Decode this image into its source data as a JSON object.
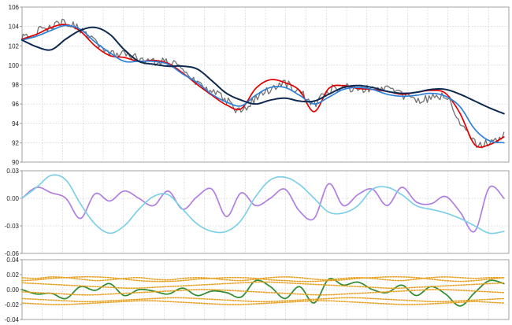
{
  "chart_data": [
    {
      "type": "line",
      "panel": "price",
      "ylim": [
        90,
        106
      ],
      "yticks": [
        "106",
        "104",
        "102",
        "100",
        "98",
        "96",
        "94",
        "92",
        "90"
      ],
      "xlim": [
        0,
        100
      ],
      "grid": true,
      "x": [
        0,
        3,
        6,
        9,
        12,
        15,
        18,
        21,
        24,
        27,
        30,
        33,
        36,
        39,
        42,
        45,
        48,
        51,
        54,
        57,
        60,
        63,
        66,
        69,
        72,
        75,
        78,
        81,
        84,
        87,
        90,
        93,
        96,
        99
      ],
      "series": [
        {
          "color": "#707070",
          "style": "noisy-price",
          "values": [
            102.9,
            103.4,
            104.1,
            104.4,
            103.6,
            102.3,
            101.2,
            101.3,
            100.6,
            100.3,
            100.3,
            99.8,
            98.2,
            97.3,
            96.4,
            95.3,
            96.6,
            97.5,
            98.0,
            97.3,
            96.1,
            97.4,
            97.7,
            97.6,
            97.6,
            97.5,
            96.9,
            96.5,
            96.6,
            96.7,
            94.2,
            91.9,
            92.1,
            92.8
          ]
        },
        {
          "color": "#e00000",
          "values": [
            102.7,
            103.2,
            103.9,
            104.2,
            103.5,
            102.0,
            101.0,
            100.8,
            100.4,
            100.5,
            100.2,
            99.2,
            98.0,
            96.9,
            95.9,
            95.5,
            97.6,
            98.5,
            98.2,
            97.4,
            95.2,
            97.6,
            97.9,
            97.6,
            97.5,
            97.3,
            97.0,
            97.2,
            97.4,
            97.1,
            95.0,
            91.8,
            91.8,
            92.6
          ]
        },
        {
          "color": "#2f80d8",
          "values": [
            102.6,
            103.0,
            103.6,
            104.1,
            103.7,
            102.4,
            101.3,
            100.4,
            100.4,
            100.4,
            100.1,
            99.1,
            98.2,
            97.0,
            96.2,
            95.8,
            96.9,
            97.7,
            97.7,
            96.9,
            96.0,
            96.7,
            97.5,
            97.7,
            97.5,
            97.0,
            96.8,
            96.9,
            97.1,
            96.8,
            95.7,
            93.4,
            92.2,
            92.0
          ]
        },
        {
          "color": "#0e2a50",
          "values": [
            102.6,
            101.9,
            101.6,
            102.7,
            103.6,
            103.9,
            103.2,
            101.6,
            100.4,
            100.1,
            99.9,
            99.9,
            99.6,
            98.4,
            97.1,
            96.4,
            96.0,
            96.4,
            96.6,
            96.3,
            96.3,
            97.0,
            97.7,
            97.9,
            97.7,
            97.3,
            97.1,
            97.2,
            97.5,
            97.5,
            97.0,
            96.3,
            95.6,
            95.0
          ]
        }
      ]
    },
    {
      "type": "line",
      "panel": "oscillator",
      "ylim": [
        -0.06,
        0.03
      ],
      "yticks": [
        "0.03",
        "0.00",
        "-0.03",
        "-0.06"
      ],
      "xlim": [
        0,
        100
      ],
      "grid": true,
      "x": [
        0,
        3,
        6,
        9,
        12,
        15,
        18,
        21,
        24,
        27,
        30,
        33,
        36,
        39,
        42,
        45,
        48,
        51,
        54,
        57,
        60,
        63,
        66,
        69,
        72,
        75,
        78,
        81,
        84,
        87,
        90,
        93,
        96,
        99
      ],
      "series": [
        {
          "color": "#b07ee0",
          "values": [
            0.0,
            0.012,
            0.006,
            0.0,
            -0.022,
            0.005,
            -0.003,
            0.008,
            0.0,
            -0.008,
            0.008,
            -0.012,
            0.002,
            0.01,
            -0.02,
            0.006,
            -0.008,
            0.0,
            0.01,
            -0.014,
            -0.022,
            0.016,
            -0.008,
            0.004,
            0.01,
            -0.008,
            0.012,
            -0.004,
            -0.006,
            0.002,
            -0.015,
            -0.036,
            0.012,
            0.0
          ]
        },
        {
          "color": "#7ecfe8",
          "values": [
            0.0,
            0.012,
            0.025,
            0.02,
            -0.006,
            -0.028,
            -0.038,
            -0.03,
            -0.012,
            0.002,
            0.004,
            -0.012,
            -0.028,
            -0.036,
            -0.036,
            -0.024,
            0.002,
            0.02,
            0.023,
            0.015,
            0.0,
            -0.015,
            -0.016,
            -0.008,
            0.01,
            0.012,
            0.004,
            -0.008,
            -0.012,
            -0.016,
            -0.022,
            -0.03,
            -0.038,
            -0.036
          ]
        }
      ]
    },
    {
      "type": "line",
      "panel": "bands",
      "ylim": [
        -0.04,
        0.04
      ],
      "yticks": [
        "0.04",
        "0.02",
        "0.00",
        "-0.02",
        "-0.04"
      ],
      "xlim": [
        0,
        100
      ],
      "grid": true,
      "x": [
        0,
        3,
        6,
        9,
        12,
        15,
        18,
        21,
        24,
        27,
        30,
        33,
        36,
        39,
        42,
        45,
        48,
        51,
        54,
        57,
        60,
        63,
        66,
        69,
        72,
        75,
        78,
        81,
        84,
        87,
        90,
        93,
        96,
        99
      ],
      "series": [
        {
          "color": "#2e8b2e",
          "values": [
            0.0,
            -0.006,
            -0.005,
            -0.012,
            0.004,
            -0.001,
            0.008,
            -0.008,
            0.0,
            -0.002,
            -0.006,
            0.002,
            -0.008,
            -0.002,
            -0.004,
            -0.01,
            0.012,
            0.004,
            -0.012,
            0.004,
            -0.018,
            0.014,
            0.006,
            0.01,
            0.0,
            -0.004,
            0.006,
            -0.008,
            0.004,
            -0.006,
            -0.022,
            -0.004,
            0.012,
            0.008
          ]
        },
        {
          "color": "#e8a020",
          "style": "dotted",
          "values": [
            0.016,
            0.015,
            0.017,
            0.016,
            0.014,
            0.012,
            0.013,
            0.015,
            0.016,
            0.014,
            0.013,
            0.015,
            0.016,
            0.015,
            0.013,
            0.012,
            0.014,
            0.016,
            0.017,
            0.016,
            0.014,
            0.013,
            0.015,
            0.016,
            0.015,
            0.013,
            0.012,
            0.014,
            0.016,
            0.017,
            0.016,
            0.015,
            0.016,
            0.016
          ]
        },
        {
          "color": "#e8a020",
          "style": "dotted",
          "values": [
            0.009,
            0.008,
            0.007,
            0.006,
            0.005,
            0.004,
            0.003,
            0.002,
            0.002,
            0.003,
            0.004,
            0.005,
            0.006,
            0.007,
            0.008,
            0.009,
            0.01,
            0.01,
            0.009,
            0.008,
            0.007,
            0.006,
            0.005,
            0.004,
            0.003,
            0.002,
            0.002,
            0.003,
            0.004,
            0.005,
            0.006,
            0.007,
            0.008,
            0.009
          ]
        },
        {
          "color": "#e8a020",
          "style": "dotted",
          "values": [
            -0.003,
            -0.004,
            -0.005,
            -0.006,
            -0.007,
            -0.007,
            -0.006,
            -0.005,
            -0.004,
            -0.003,
            -0.002,
            -0.001,
            0.0,
            0.0,
            -0.001,
            -0.002,
            -0.003,
            -0.004,
            -0.005,
            -0.006,
            -0.007,
            -0.007,
            -0.006,
            -0.005,
            -0.004,
            -0.003,
            -0.002,
            -0.001,
            0.0,
            0.0,
            -0.001,
            -0.002,
            -0.003,
            -0.004
          ]
        },
        {
          "color": "#e8a020",
          "style": "dotted",
          "values": [
            -0.012,
            -0.013,
            -0.014,
            -0.015,
            -0.016,
            -0.016,
            -0.015,
            -0.014,
            -0.013,
            -0.012,
            -0.011,
            -0.011,
            -0.012,
            -0.013,
            -0.014,
            -0.015,
            -0.016,
            -0.016,
            -0.015,
            -0.014,
            -0.013,
            -0.012,
            -0.011,
            -0.011,
            -0.012,
            -0.013,
            -0.014,
            -0.015,
            -0.016,
            -0.016,
            -0.015,
            -0.014,
            -0.013,
            -0.012
          ]
        },
        {
          "color": "#e8a020",
          "style": "dotted",
          "values": [
            0.012,
            0.013,
            0.015,
            0.016,
            0.017,
            0.017,
            0.016,
            0.014,
            0.012,
            0.011,
            0.011,
            0.012,
            0.014,
            0.015,
            0.016,
            0.016,
            0.015,
            0.013,
            0.012,
            0.011,
            0.011,
            0.012,
            0.013,
            0.015,
            0.016,
            0.017,
            0.017,
            0.016,
            0.014,
            0.012,
            0.011,
            0.012,
            0.014,
            0.016
          ]
        },
        {
          "color": "#e8a020",
          "style": "dotted",
          "values": [
            -0.018,
            -0.019,
            -0.02,
            -0.02,
            -0.019,
            -0.018,
            -0.017,
            -0.016,
            -0.015,
            -0.015,
            -0.016,
            -0.017,
            -0.018,
            -0.019,
            -0.02,
            -0.02,
            -0.019,
            -0.018,
            -0.017,
            -0.016,
            -0.015,
            -0.015,
            -0.016,
            -0.017,
            -0.018,
            -0.019,
            -0.02,
            -0.02,
            -0.019,
            -0.018,
            -0.017,
            -0.016,
            -0.017,
            -0.018
          ]
        }
      ]
    }
  ]
}
